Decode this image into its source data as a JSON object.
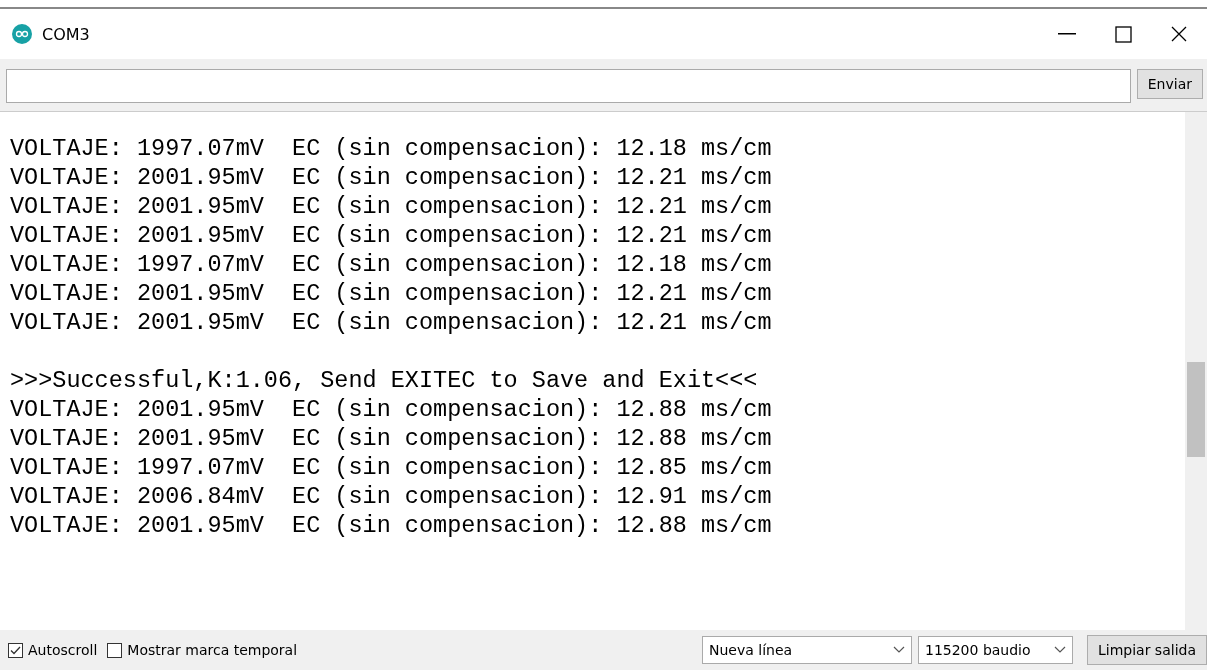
{
  "window": {
    "title": "COM3"
  },
  "send_button": "Enviar",
  "output_blocks": [
    {
      "lines": [
        "VOLTAJE: 1997.07mV  EC (sin compensacion): 12.18 ms/cm",
        "VOLTAJE: 2001.95mV  EC (sin compensacion): 12.21 ms/cm",
        "VOLTAJE: 2001.95mV  EC (sin compensacion): 12.21 ms/cm",
        "VOLTAJE: 2001.95mV  EC (sin compensacion): 12.21 ms/cm",
        "VOLTAJE: 1997.07mV  EC (sin compensacion): 12.18 ms/cm",
        "VOLTAJE: 2001.95mV  EC (sin compensacion): 12.21 ms/cm",
        "VOLTAJE: 2001.95mV  EC (sin compensacion): 12.21 ms/cm"
      ]
    },
    {
      "lines": [
        ">>>Successful,K:1.06, Send EXITEC to Save and Exit<<<",
        "VOLTAJE: 2001.95mV  EC (sin compensacion): 12.88 ms/cm",
        "VOLTAJE: 2001.95mV  EC (sin compensacion): 12.88 ms/cm",
        "VOLTAJE: 1997.07mV  EC (sin compensacion): 12.85 ms/cm",
        "VOLTAJE: 2006.84mV  EC (sin compensacion): 12.91 ms/cm",
        "VOLTAJE: 2001.95mV  EC (sin compensacion): 12.88 ms/cm"
      ]
    }
  ],
  "footer": {
    "checkboxes": [
      {
        "label": "Autoscroll",
        "checked": true
      },
      {
        "label": "Mostrar marca temporal",
        "checked": false
      }
    ],
    "line_ending": "Nueva línea",
    "baud_rate": "115200 baudio",
    "clear_button": "Limpiar salida"
  }
}
